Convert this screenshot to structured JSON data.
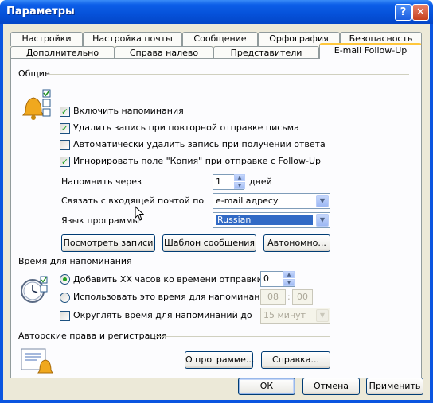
{
  "window": {
    "title": "Параметры",
    "help_glyph": "?",
    "close_glyph": "✕"
  },
  "tabs_row1": [
    "Настройки",
    "Настройка почты",
    "Сообщение",
    "Орфография",
    "Безопасность"
  ],
  "tabs_row2": [
    "Дополнительно",
    "Справа налево",
    "Представители",
    "E-mail Follow-Up"
  ],
  "general": {
    "heading": "Общие",
    "checkboxes": [
      {
        "label": "Включить напоминания",
        "checked": true
      },
      {
        "label": "Удалить запись при повторной отправке письма",
        "checked": true
      },
      {
        "label": "Автоматически удалить запись при получении ответа",
        "checked": false
      },
      {
        "label": "Игнорировать поле \"Копия\" при отправке с Follow-Up",
        "checked": true
      }
    ],
    "remind_label": "Напомнить через",
    "remind_value": "1",
    "remind_unit": "дней",
    "link_label": "Связать с входящей почтой по",
    "link_value": "e-mail адресу",
    "lang_label": "Язык программы",
    "lang_value": "Russian",
    "buttons": [
      "Посмотреть записи",
      "Шаблон сообщения",
      "Автономно..."
    ]
  },
  "reminder_time": {
    "heading": "Время для напоминания",
    "option1": "Добавить XX часов ко времени отправки",
    "option1_value": "0",
    "option1_selected": true,
    "option2": "Использовать это время для напоминаний:",
    "hour": "08",
    "minute": "00",
    "round_label": "Округлять время для напоминаний до",
    "round_value": "15 минут"
  },
  "copyright": {
    "heading": "Авторские права и регистрация",
    "about_button": "О программе...",
    "help_button": "Справка..."
  },
  "footer": {
    "ok": "ОК",
    "cancel": "Отмена",
    "apply": "Применить"
  },
  "colors": {
    "title_bar": "#0551d9",
    "selection": "#316ac5",
    "check": "#21a121"
  }
}
